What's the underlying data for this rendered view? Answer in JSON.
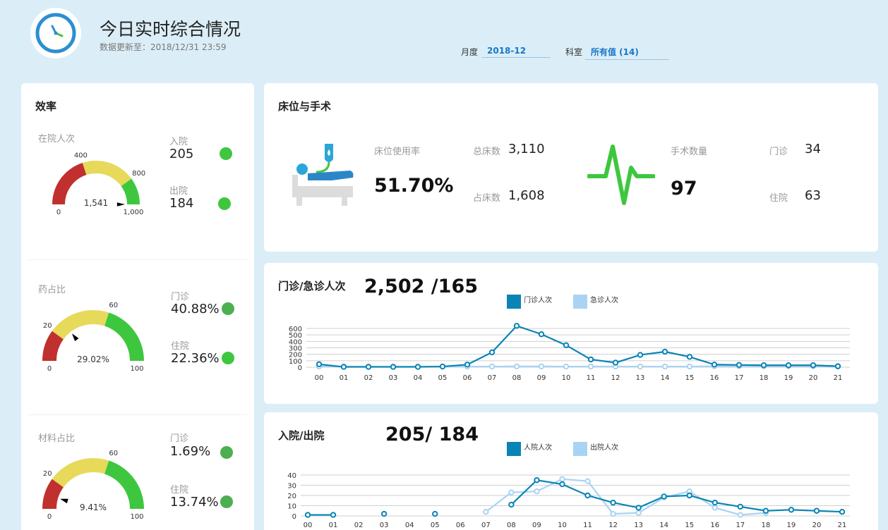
{
  "header": {
    "title": "今日实时综合情况",
    "updated": "数据更新至：2018/12/31 23:59",
    "filters": [
      {
        "label": "月度",
        "value": "2018-12"
      },
      {
        "label": "科室",
        "value": "所有值 (14)"
      }
    ]
  },
  "efficiency": {
    "title": "效率",
    "gauges": [
      {
        "label": "在院人次",
        "value": 1541,
        "value_text": "1,541",
        "min_label": "0",
        "max_label": "1,000",
        "t1_label": "400",
        "t2_label": "800",
        "min": 0,
        "max": 1000,
        "t1": 400,
        "t2": 800,
        "items": [
          {
            "label": "入院",
            "value": "205",
            "dot_color": "#3ec73e"
          },
          {
            "label": "出院",
            "value": "184",
            "dot_color": "#3ec73e"
          }
        ]
      },
      {
        "label": "药占比",
        "value": 29.02,
        "value_text": "29.02%",
        "min_label": "0",
        "max_label": "100",
        "t1_label": "20",
        "t2_label": "60",
        "min": 0,
        "max": 100,
        "t1": 20,
        "t2": 60,
        "items": [
          {
            "label": "门诊",
            "value": "40.88%",
            "dot_color": "#4caf50"
          },
          {
            "label": "住院",
            "value": "22.36%",
            "dot_color": "#3ec73e"
          }
        ]
      },
      {
        "label": "材料占比",
        "value": 9.41,
        "value_text": "9.41%",
        "min_label": "0",
        "max_label": "100",
        "t1_label": "20",
        "t2_label": "60",
        "min": 0,
        "max": 100,
        "t1": 20,
        "t2": 60,
        "items": [
          {
            "label": "门诊",
            "value": "1.69%",
            "dot_color": "#4caf50"
          },
          {
            "label": "住院",
            "value": "13.74%",
            "dot_color": "#4caf50"
          }
        ]
      }
    ]
  },
  "beds": {
    "title": "床位与手术",
    "usage_label": "床位使用率",
    "usage_value": "51.70%",
    "total_label": "总床数",
    "total_value": "3,110",
    "occupied_label": "占床数",
    "occupied_value": "1,608",
    "surgery_label": "手术数量",
    "surgery_value": "97",
    "outpatient_label": "门诊",
    "outpatient_value": "34",
    "inpatient_label": "住院",
    "inpatient_value": "63"
  },
  "colors": {
    "dark_series": "#0a84b5",
    "light_series": "#a9d3f3",
    "red": "#c0302e",
    "yellow": "#e7d95a",
    "green": "#3ec73e"
  },
  "chart_data": [
    {
      "type": "line",
      "title": "门诊/急诊人次",
      "headline": "2,502 /165",
      "categories": [
        "00",
        "01",
        "02",
        "03",
        "04",
        "05",
        "06",
        "07",
        "08",
        "09",
        "10",
        "11",
        "12",
        "13",
        "14",
        "15",
        "16",
        "17",
        "18",
        "19",
        "20",
        "21"
      ],
      "yticks": [
        0,
        100,
        200,
        300,
        400,
        500,
        600
      ],
      "ylim": [
        0,
        600
      ],
      "legend": "top-center",
      "grid": true,
      "series": [
        {
          "name": "门诊人次",
          "values": [
            45,
            5,
            5,
            5,
            5,
            10,
            40,
            230,
            640,
            510,
            340,
            120,
            70,
            190,
            240,
            160,
            40,
            35,
            30,
            30,
            30,
            15
          ]
        },
        {
          "name": "急诊人次",
          "values": [
            10,
            10,
            10,
            10,
            10,
            10,
            10,
            10,
            12,
            12,
            10,
            10,
            10,
            10,
            10,
            10,
            15,
            15,
            15,
            15,
            15,
            10
          ]
        }
      ]
    },
    {
      "type": "line",
      "title": "入院/出院",
      "headline": "205/ 184",
      "categories": [
        "00",
        "01",
        "02",
        "03",
        "04",
        "05",
        "06",
        "07",
        "08",
        "09",
        "10",
        "11",
        "12",
        "13",
        "14",
        "15",
        "16",
        "17",
        "18",
        "19",
        "20",
        "21"
      ],
      "yticks": [
        0,
        10,
        20,
        30,
        40
      ],
      "ylim": [
        0,
        40
      ],
      "legend": "top-center",
      "grid": true,
      "series": [
        {
          "name": "人院人次",
          "values": [
            1,
            1,
            null,
            2,
            null,
            2,
            null,
            null,
            11,
            35,
            31,
            20,
            13,
            8,
            19,
            20,
            13,
            9,
            5,
            6,
            5,
            4
          ]
        },
        {
          "name": "出院人次",
          "values": [
            null,
            null,
            null,
            null,
            null,
            null,
            null,
            4,
            23,
            24,
            36,
            34,
            2,
            3,
            18,
            24,
            8,
            1,
            3,
            null,
            null,
            null
          ]
        }
      ]
    }
  ]
}
